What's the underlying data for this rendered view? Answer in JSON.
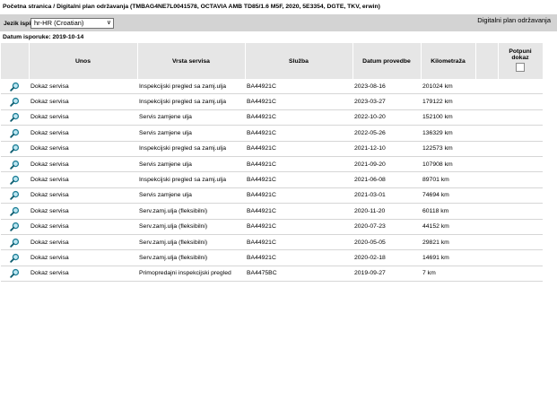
{
  "breadcrumb": "Početna stranica / Digitalni plan održavanja (TMBAG4NE7L0041578, OCTAVIA AMB TD85/1.6 M5F, 2020, 5E3354, DGTE, TKV, erwin)",
  "toolbar": {
    "language_label": "Jezik ispisa:",
    "language_value": "hr-HR (Croatian)",
    "page_heading": "Digitalni plan održavanja"
  },
  "delivery_date": "Datum isporuke: 2019-10-14",
  "columns": {
    "entry": "Unos",
    "service_type": "Vrsta servisa",
    "service": "Služba",
    "date": "Datum provedbe",
    "mileage": "Kilometraža",
    "full_proof_line1": "Potpuni",
    "full_proof_line2": "dokaz"
  },
  "icons": {
    "view": "magnifier-icon"
  },
  "rows": [
    {
      "entry": "Dokaz servisa",
      "type": "Inspekcijski pregled sa zamj.ulja",
      "service": "BA44921C",
      "date": "2023-08-16",
      "km": "201024 km"
    },
    {
      "entry": "Dokaz servisa",
      "type": "Inspekcijski pregled sa zamj.ulja",
      "service": "BA44921C",
      "date": "2023-03-27",
      "km": "179122 km"
    },
    {
      "entry": "Dokaz servisa",
      "type": "Servis zamjene ulja",
      "service": "BA44921C",
      "date": "2022-10-20",
      "km": "152100 km"
    },
    {
      "entry": "Dokaz servisa",
      "type": "Servis zamjene ulja",
      "service": "BA44921C",
      "date": "2022-05-26",
      "km": "136329 km"
    },
    {
      "entry": "Dokaz servisa",
      "type": "Inspekcijski pregled sa zamj.ulja",
      "service": "BA44921C",
      "date": "2021-12-10",
      "km": "122573 km"
    },
    {
      "entry": "Dokaz servisa",
      "type": "Servis zamjene ulja",
      "service": "BA44921C",
      "date": "2021-09-20",
      "km": "107908 km"
    },
    {
      "entry": "Dokaz servisa",
      "type": "Inspekcijski pregled sa zamj.ulja",
      "service": "BA44921C",
      "date": "2021-06-08",
      "km": "89701 km"
    },
    {
      "entry": "Dokaz servisa",
      "type": "Servis zamjene ulja",
      "service": "BA44921C",
      "date": "2021-03-01",
      "km": "74694 km"
    },
    {
      "entry": "Dokaz servisa",
      "type": "Serv.zamj.ulja (fleksibilni)",
      "service": "BA44921C",
      "date": "2020-11-20",
      "km": "60118 km"
    },
    {
      "entry": "Dokaz servisa",
      "type": "Serv.zamj.ulja (fleksibilni)",
      "service": "BA44921C",
      "date": "2020-07-23",
      "km": "44152 km"
    },
    {
      "entry": "Dokaz servisa",
      "type": "Serv.zamj.ulja (fleksibilni)",
      "service": "BA44921C",
      "date": "2020-05-05",
      "km": "29821 km"
    },
    {
      "entry": "Dokaz servisa",
      "type": "Serv.zamj.ulja (fleksibilni)",
      "service": "BA44921C",
      "date": "2020-02-18",
      "km": "14691 km"
    },
    {
      "entry": "Dokaz servisa",
      "type": "Primopredajni inspekcijski pregled",
      "service": "BA4475BC",
      "date": "2019-09-27",
      "km": "7 km"
    }
  ]
}
